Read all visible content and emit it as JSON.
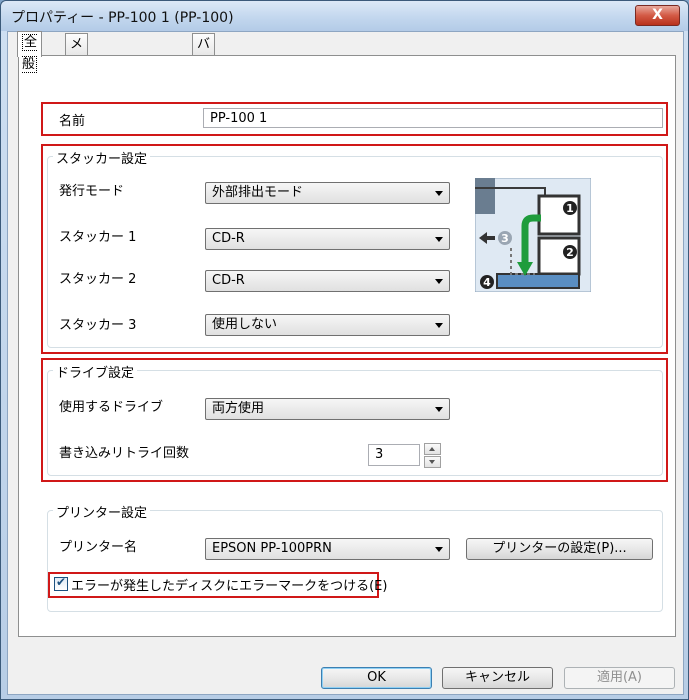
{
  "window": {
    "title": "プロパティー - PP-100 1 (PP-100)",
    "close_label": "X"
  },
  "tabs": [
    {
      "label": "全般"
    },
    {
      "label": "メンテナンス情報"
    },
    {
      "label": "バージョン情報"
    }
  ],
  "name": {
    "label": "名前",
    "value": "PP-100 1"
  },
  "stacker": {
    "group_label": "スタッカー設定",
    "rows": [
      {
        "label": "発行モード",
        "value": "外部排出モード"
      },
      {
        "label": "スタッカー 1",
        "value": "CD-R"
      },
      {
        "label": "スタッカー 2",
        "value": "CD-R"
      },
      {
        "label": "スタッカー 3",
        "value": "使用しない"
      }
    ],
    "diagram_numbers": [
      "1",
      "2",
      "3",
      "4"
    ]
  },
  "drive": {
    "group_label": "ドライブ設定",
    "drive_label": "使用するドライブ",
    "drive_value": "両方使用",
    "retry_label": "書き込みリトライ回数",
    "retry_value": "3"
  },
  "printer": {
    "group_label": "プリンター設定",
    "name_label": "プリンター名",
    "name_value": "EPSON PP-100PRN",
    "settings_button": "プリンターの設定(P)...",
    "error_mark_label": "エラーが発生したディスクにエラーマークをつける(E)",
    "error_mark_checked": true
  },
  "buttons": {
    "ok": "OK",
    "cancel": "キャンセル",
    "apply": "適用(A)"
  }
}
